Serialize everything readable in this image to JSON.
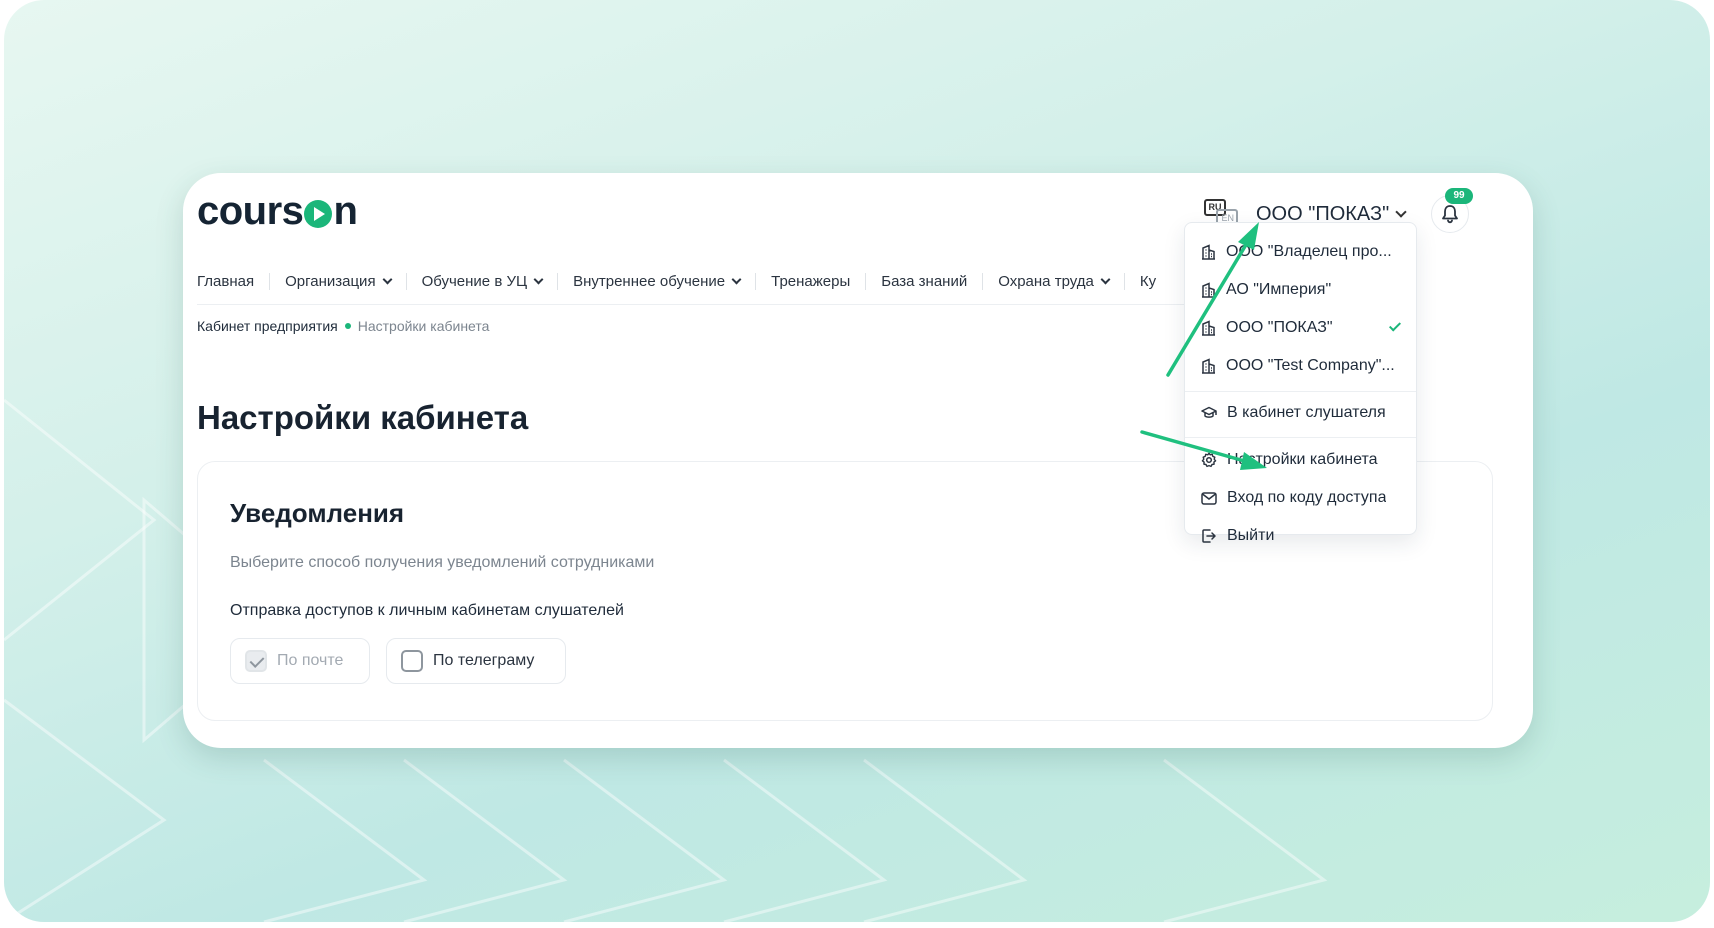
{
  "app": {
    "logo": "courson",
    "logo_parts": [
      "cours",
      "n"
    ],
    "accent_color": "#1bb67a"
  },
  "header": {
    "lang_primary": "RU",
    "lang_secondary": "EN",
    "company": "ООО \"ПОКАЗ\"",
    "notifications_count": "99"
  },
  "nav": [
    {
      "label": "Главная",
      "has_menu": false
    },
    {
      "label": "Организация",
      "has_menu": true
    },
    {
      "label": "Обучение в УЦ",
      "has_menu": true
    },
    {
      "label": "Внутреннее обучение",
      "has_menu": true
    },
    {
      "label": "Тренажеры",
      "has_menu": false
    },
    {
      "label": "База знаний",
      "has_menu": false
    },
    {
      "label": "Охрана труда",
      "has_menu": true
    },
    {
      "label": "Ку",
      "has_menu": false
    }
  ],
  "breadcrumb": {
    "first": "Кабинет предприятия",
    "second": "Настройки кабинета"
  },
  "page": {
    "title": "Настройки кабинета"
  },
  "notifications_card": {
    "title": "Уведомления",
    "subtitle": "Выберите способ получения уведомлений сотрудниками",
    "label": "Отправка доступов к личным кабинетам слушателей",
    "options": [
      {
        "label": "По почте",
        "checked": true,
        "disabled": true
      },
      {
        "label": "По телеграму",
        "checked": false,
        "disabled": false
      }
    ]
  },
  "dropdown": {
    "companies": [
      {
        "label": "ООО \"Владелец про...",
        "selected": false
      },
      {
        "label": "АО \"Империя\"",
        "selected": false
      },
      {
        "label": "ООО \"ПОКАЗ\"",
        "selected": true
      },
      {
        "label": "ООО \"Test Company\"...",
        "selected": false
      }
    ],
    "student_cabinet": "В кабинет слушателя",
    "settings": "Настройки кабинета",
    "access_code": "Вход по коду доступа",
    "logout": "Выйти"
  }
}
